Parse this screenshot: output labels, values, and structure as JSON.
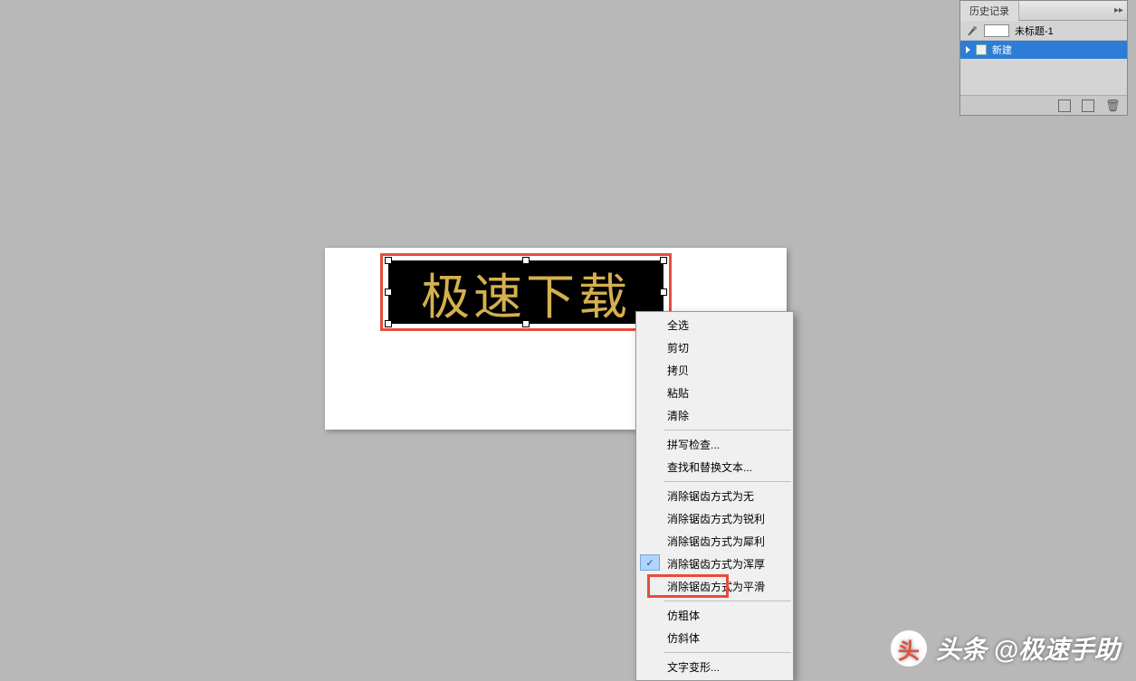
{
  "history_panel": {
    "tab_label": "历史记录",
    "doc_name": "未标题-1",
    "items": [
      {
        "label": "新建"
      }
    ]
  },
  "canvas": {
    "text": "极速下载"
  },
  "context_menu": {
    "groups": [
      [
        {
          "label": "全选",
          "checked": false
        },
        {
          "label": "剪切",
          "checked": false
        },
        {
          "label": "拷贝",
          "checked": false
        },
        {
          "label": "粘贴",
          "checked": false
        },
        {
          "label": "清除",
          "checked": false
        }
      ],
      [
        {
          "label": "拼写检查...",
          "checked": false
        },
        {
          "label": "查找和替换文本...",
          "checked": false
        }
      ],
      [
        {
          "label": "消除锯齿方式为无",
          "checked": false
        },
        {
          "label": "消除锯齿方式为锐利",
          "checked": false
        },
        {
          "label": "消除锯齿方式为犀利",
          "checked": false
        },
        {
          "label": "消除锯齿方式为浑厚",
          "checked": true
        },
        {
          "label": "消除锯齿方式为平滑",
          "checked": false
        }
      ],
      [
        {
          "label": "仿粗体",
          "checked": false,
          "highlighted": true
        },
        {
          "label": "仿斜体",
          "checked": false
        }
      ],
      [
        {
          "label": "文字变形...",
          "checked": false
        }
      ]
    ]
  },
  "watermark": {
    "logo_text": "头",
    "text": "头条 @极速手助"
  }
}
